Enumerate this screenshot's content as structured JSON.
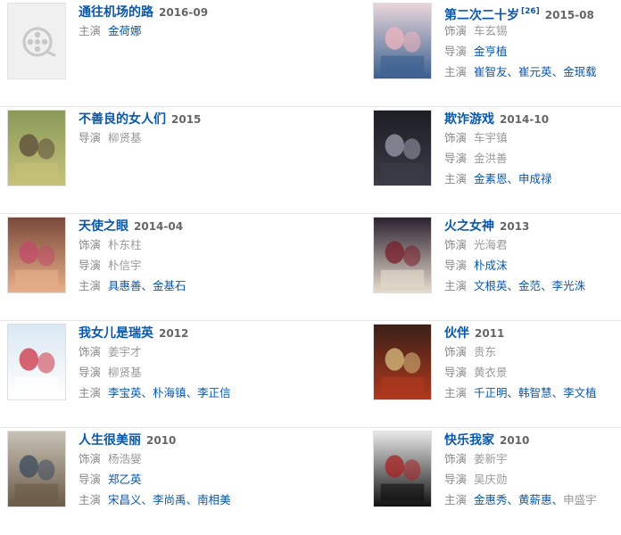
{
  "movies": [
    {
      "title": "通往机场的路",
      "date": "2016-09",
      "sup": "",
      "credits": [
        {
          "role": "主演",
          "names": [
            "金荷娜"
          ],
          "linked": true
        }
      ]
    },
    {
      "title": "第二次二十岁",
      "date": "2015-08",
      "sup": "[26]",
      "credits": [
        {
          "role": "饰演",
          "names": [
            "车玄锡"
          ],
          "linked": false
        },
        {
          "role": "导演",
          "names": [
            "金亨植"
          ],
          "linked": true
        },
        {
          "role": "主演",
          "names": [
            "崔智友",
            "崔元英",
            "金珉载"
          ],
          "linked": true
        }
      ]
    },
    {
      "title": "不善良的女人们",
      "date": "2015",
      "sup": "",
      "credits": [
        {
          "role": "导演",
          "names": [
            "柳贤基"
          ],
          "linked": false
        }
      ]
    },
    {
      "title": "欺诈游戏",
      "date": "2014-10",
      "sup": "",
      "credits": [
        {
          "role": "饰演",
          "names": [
            "车宇镇"
          ],
          "linked": false
        },
        {
          "role": "导演",
          "names": [
            "金洪善"
          ],
          "linked": false
        },
        {
          "role": "主演",
          "names": [
            "金素恩",
            "申成禄"
          ],
          "linked": true
        }
      ]
    },
    {
      "title": "天使之眼",
      "date": "2014-04",
      "sup": "",
      "credits": [
        {
          "role": "饰演",
          "names": [
            "朴东柱"
          ],
          "linked": false
        },
        {
          "role": "导演",
          "names": [
            "朴信宇"
          ],
          "linked": false
        },
        {
          "role": "主演",
          "names": [
            "具惠善",
            "金基石"
          ],
          "linked": true
        }
      ]
    },
    {
      "title": "火之女神",
      "date": "2013",
      "sup": "",
      "credits": [
        {
          "role": "饰演",
          "names": [
            "光海君"
          ],
          "linked": false
        },
        {
          "role": "导演",
          "names": [
            "朴成沫"
          ],
          "linked": true
        },
        {
          "role": "主演",
          "names": [
            "文根英",
            "金范",
            "李光洙"
          ],
          "linked": true
        }
      ]
    },
    {
      "title": "我女儿是瑞英",
      "date": "2012",
      "sup": "",
      "credits": [
        {
          "role": "饰演",
          "names": [
            "姜宇才"
          ],
          "linked": false
        },
        {
          "role": "导演",
          "names": [
            "柳贤基"
          ],
          "linked": false
        },
        {
          "role": "主演",
          "names": [
            "李宝英",
            "朴海镇",
            "李正信"
          ],
          "linked": true
        }
      ]
    },
    {
      "title": "伙伴",
      "date": "2011",
      "sup": "",
      "credits": [
        {
          "role": "饰演",
          "names": [
            "贵东"
          ],
          "linked": false
        },
        {
          "role": "导演",
          "names": [
            "黄衣景"
          ],
          "linked": false
        },
        {
          "role": "主演",
          "names": [
            "千正明",
            "韩智慧",
            "李文植"
          ],
          "linked": true
        }
      ]
    },
    {
      "title": "人生很美丽",
      "date": "2010",
      "sup": "",
      "credits": [
        {
          "role": "饰演",
          "names": [
            "杨浩燮"
          ],
          "linked": false
        },
        {
          "role": "导演",
          "names": [
            "郑乙英"
          ],
          "linked": true
        },
        {
          "role": "主演",
          "names": [
            "宋昌义",
            "李尚禹",
            "南相美"
          ],
          "linked": true
        }
      ]
    },
    {
      "title": "快乐我家",
      "date": "2010",
      "sup": "",
      "credits": [
        {
          "role": "饰演",
          "names": [
            "姜新宇"
          ],
          "linked": false
        },
        {
          "role": "导演",
          "names": [
            "吴庆勋"
          ],
          "linked": false
        },
        {
          "role": "主演",
          "names": [
            "金惠秀",
            "黄薪惠",
            "申盛宇"
          ],
          "linked": "partial"
        }
      ]
    }
  ],
  "colors": {
    "link": "#0b57a8",
    "muted": "#999999",
    "divider": "#e6e6e6"
  }
}
